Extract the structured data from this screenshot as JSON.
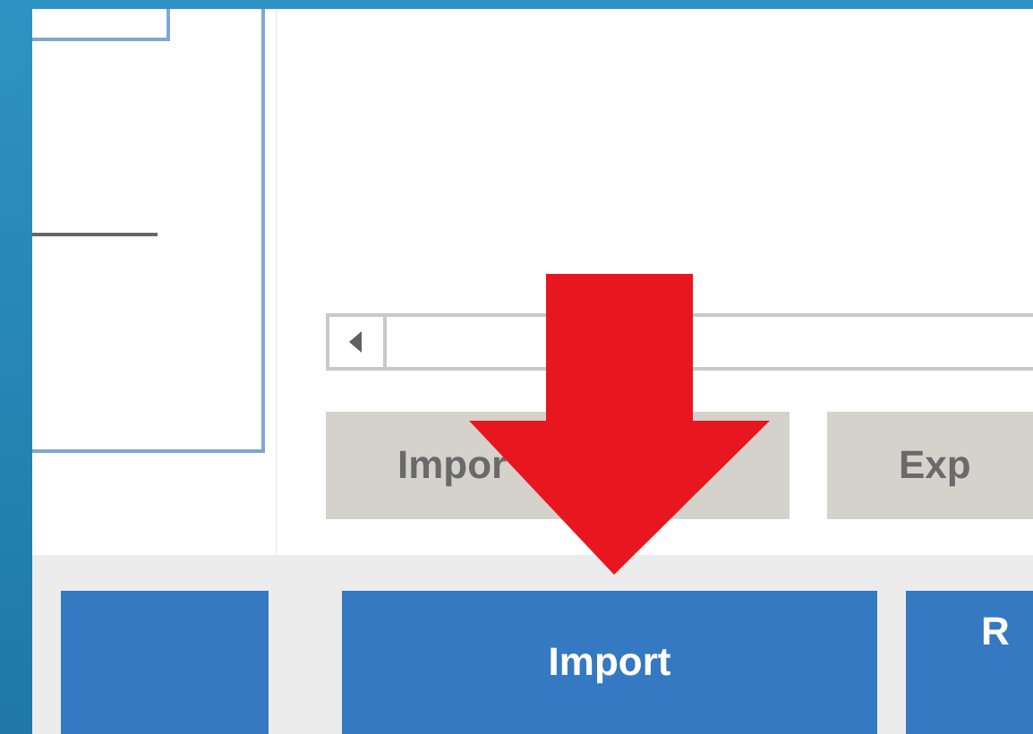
{
  "action_buttons": [
    {
      "label": "Impor",
      "disabled": true
    },
    {
      "label": "Exp",
      "disabled": true
    }
  ],
  "bottom_buttons": [
    {
      "kind": "blank"
    },
    {
      "kind": "text",
      "label": "Import"
    },
    {
      "kind": "text",
      "label": "R"
    }
  ],
  "annotation": {
    "kind": "arrow"
  }
}
